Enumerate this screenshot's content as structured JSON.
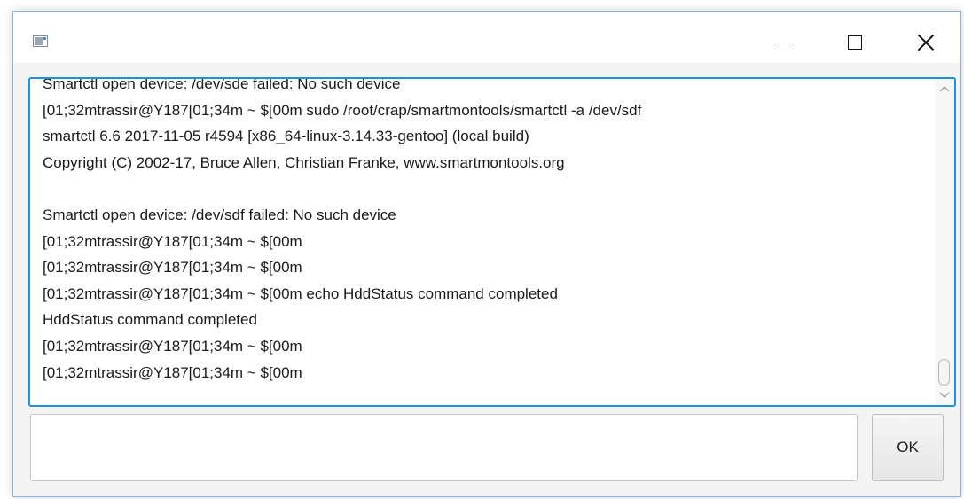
{
  "window": {
    "icon": "app-window-icon",
    "controls": {
      "minimize": "minimize-icon",
      "maximize": "maximize-icon",
      "close": "close-icon"
    }
  },
  "console": {
    "lines": [
      "Smartctl open device: /dev/sde failed: No such device",
      "[01;32mtrassir@Y187[01;34m ~ $[00m sudo /root/crap/smartmontools/smartctl -a /dev/sdf",
      "smartctl 6.6 2017-11-05 r4594 [x86_64-linux-3.14.33-gentoo] (local build)",
      "Copyright (C) 2002-17, Bruce Allen, Christian Franke, www.smartmontools.org",
      "",
      "Smartctl open device: /dev/sdf failed: No such device",
      "[01;32mtrassir@Y187[01;34m ~ $[00m",
      "[01;32mtrassir@Y187[01;34m ~ $[00m",
      "[01;32mtrassir@Y187[01;34m ~ $[00m echo HddStatus command completed",
      "HddStatus command completed",
      "[01;32mtrassir@Y187[01;34m ~ $[00m",
      "[01;32mtrassir@Y187[01;34m ~ $[00m"
    ],
    "scroll_position": 1.0
  },
  "input": {
    "value": "",
    "placeholder": ""
  },
  "ok_button": {
    "label": "OK"
  },
  "colors": {
    "focus_border": "#1e90e0",
    "window_border": "#8ab5de"
  }
}
